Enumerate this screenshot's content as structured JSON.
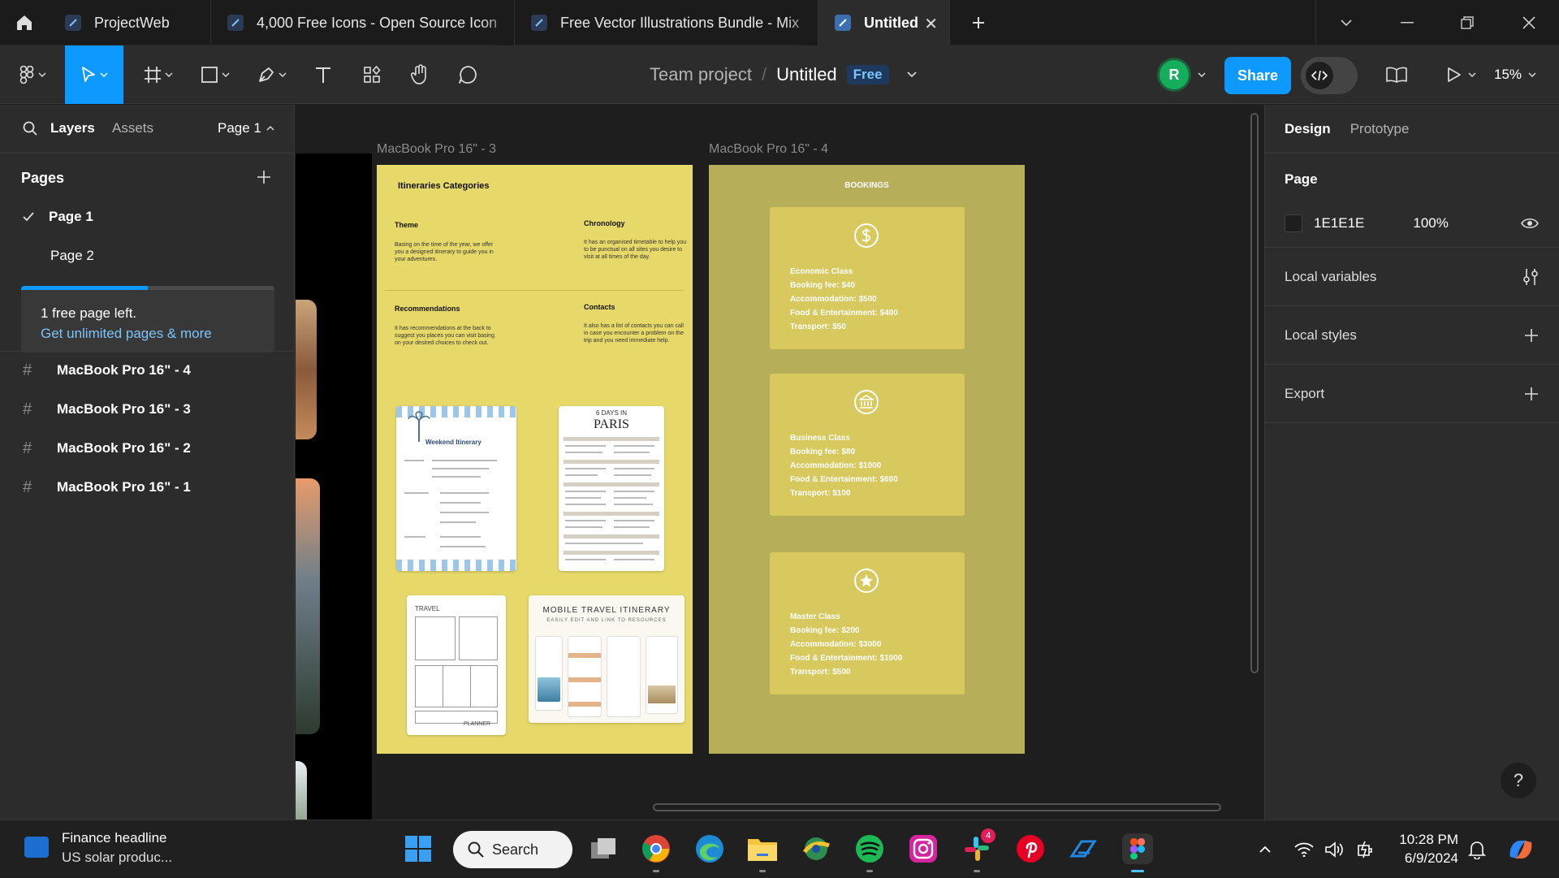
{
  "tabs": [
    {
      "title": "ProjectWeb",
      "active": false
    },
    {
      "title": "4,000 Free Icons - Open Source Icon",
      "active": false
    },
    {
      "title": "Free Vector Illustrations Bundle - Mix",
      "active": false
    },
    {
      "title": "Untitled",
      "active": true
    }
  ],
  "header": {
    "team": "Team project",
    "separator": "/",
    "file": "Untitled",
    "plan_badge": "Free",
    "avatar_initial": "R",
    "share_label": "Share",
    "zoom": "15%"
  },
  "left_panel": {
    "tab_layers": "Layers",
    "tab_assets": "Assets",
    "page_selector": "Page 1",
    "pages_title": "Pages",
    "pages": [
      {
        "name": "Page 1",
        "selected": true
      },
      {
        "name": "Page 2",
        "selected": false
      }
    ],
    "promo": {
      "title": "1 free page left.",
      "link": "Get unlimited pages & more",
      "progress": 0.5
    },
    "layers": [
      "MacBook Pro 16\" - 4",
      "MacBook Pro 16\" - 3",
      "MacBook Pro 16\" - 2",
      "MacBook Pro 16\" - 1"
    ]
  },
  "canvas": {
    "frame3": {
      "label": "MacBook Pro 16\" - 3",
      "heading": "Itineraries Categories",
      "sections": [
        {
          "title": "Theme",
          "body": "Basing on the time of the year, we offer you a designed itinerary to guide you in your adventures."
        },
        {
          "title": "Chronology",
          "body": "It has an organised timetable to help you to be punctual on all sites you desire to visit at all times of the day."
        },
        {
          "title": "Recommendations",
          "body": "It has recommendations at the back to suggest you places you can visit basing on your desired choices to check out."
        },
        {
          "title": "Contacts",
          "body": "It also has a list of contacts you can call in case you encounter a problem on the trip and you need immediate help."
        }
      ],
      "thumb_paris_top": "6 DAYS IN",
      "thumb_paris_title": "PARIS",
      "thumb_weekend_title": "Weekend Itinerary",
      "thumb_travel": "TRAVEL",
      "thumb_planner": "PLANNER",
      "thumb_mobile_title": "MOBILE TRAVEL ITINERARY",
      "thumb_mobile_sub": "EASILY EDIT AND LINK TO RESOURCES"
    },
    "frame4": {
      "label": "MacBook Pro 16\" - 4",
      "heading": "BOOKINGS",
      "cards": [
        {
          "icon": "dollar-icon",
          "lines": [
            "Economic Class",
            "Booking fee: $40",
            "Accommodation: $500",
            "Food & Entertainment: $400",
            "Transport: $50"
          ]
        },
        {
          "icon": "bank-icon",
          "lines": [
            "Business Class",
            "Booking fee: $80",
            "Accommodation: $1000",
            "Food & Entertainment: $600",
            "Transport: $100"
          ]
        },
        {
          "icon": "star-icon",
          "lines": [
            "Master Class",
            "Booking fee: $200",
            "Accommodation: $3000",
            "Food & Entertainment: $1000",
            "Transport: $500"
          ]
        }
      ]
    }
  },
  "right_panel": {
    "tab_design": "Design",
    "tab_prototype": "Prototype",
    "page_section": "Page",
    "bg_color": "1E1E1E",
    "bg_opacity": "100%",
    "local_variables": "Local variables",
    "local_styles": "Local styles",
    "export": "Export",
    "help": "?"
  },
  "taskbar": {
    "news_title": "Finance headline",
    "news_sub": "US solar produc...",
    "search_label": "Search",
    "notification_count": "4",
    "time": "10:28 PM",
    "date": "6/9/2024"
  },
  "colors": {
    "accent": "#0d99ff",
    "frame3_bg": "#e7d969",
    "frame4_bg": "#b7ae59",
    "avatar": "#14ae5c"
  }
}
